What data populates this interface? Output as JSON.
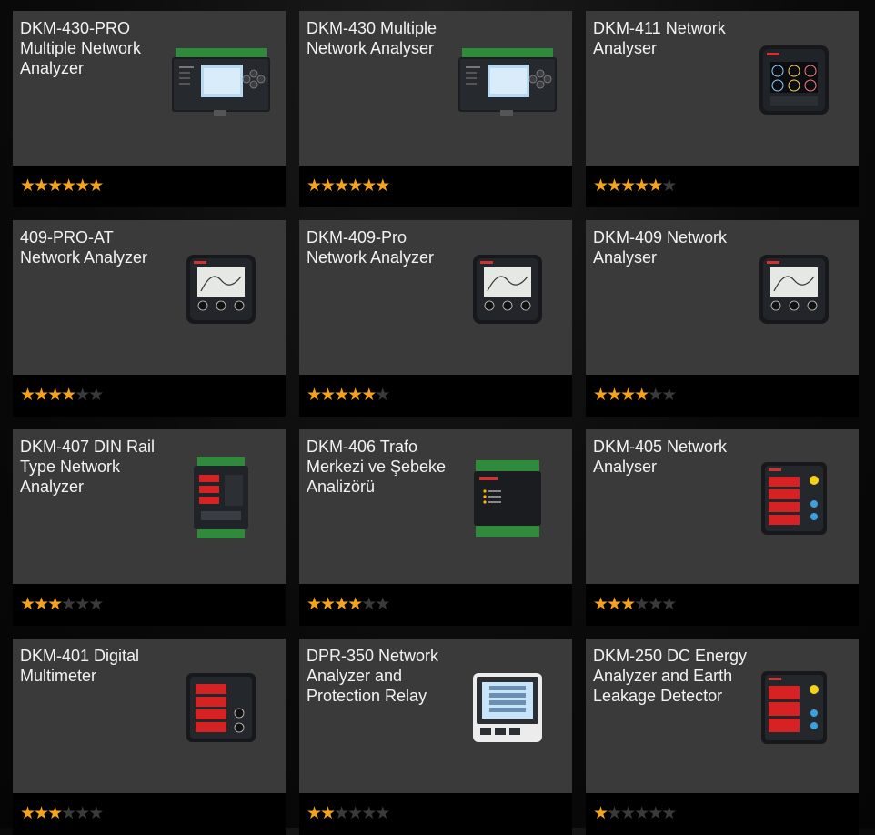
{
  "products": [
    {
      "title": "DKM-430-PRO Multiple Network Analyzer",
      "rating": 6,
      "device": "din-wide"
    },
    {
      "title": "DKM-430 Multiple Network Analyser",
      "rating": 6,
      "device": "din-wide"
    },
    {
      "title": "DKM-411 Network Analyser",
      "rating": 5,
      "device": "panel-color"
    },
    {
      "title": "409-PRO-AT Network Analyzer",
      "rating": 4,
      "device": "panel-lcd"
    },
    {
      "title": "DKM-409-Pro Network Analyzer",
      "rating": 5,
      "device": "panel-lcd"
    },
    {
      "title": "DKM-409 Network Analyser",
      "rating": 4,
      "device": "panel-lcd"
    },
    {
      "title": "DKM-407 DIN Rail Type Network Analyzer",
      "rating": 3,
      "device": "din-red"
    },
    {
      "title": "DKM-406 Trafo Merkezi ve Şebeke Analizörü",
      "rating": 4,
      "device": "din-green"
    },
    {
      "title": "DKM-405 Network Analyser",
      "rating": 3,
      "device": "panel-red-tall"
    },
    {
      "title": "DKM-401 Digital Multimeter",
      "rating": 3,
      "device": "panel-red-4"
    },
    {
      "title": "DPR-350 Network Analyzer and Protection Relay",
      "rating": 2,
      "device": "panel-lcd-blue"
    },
    {
      "title": "DKM-250 DC Energy Analyzer and Earth Leakage Detector",
      "rating": 1,
      "device": "panel-red-3"
    }
  ],
  "rating_max": 6,
  "colors": {
    "star_on": "#f7a21b",
    "star_off": "#3a3a3a",
    "card": "#3a3a3a",
    "rating_bar": "#000000"
  }
}
